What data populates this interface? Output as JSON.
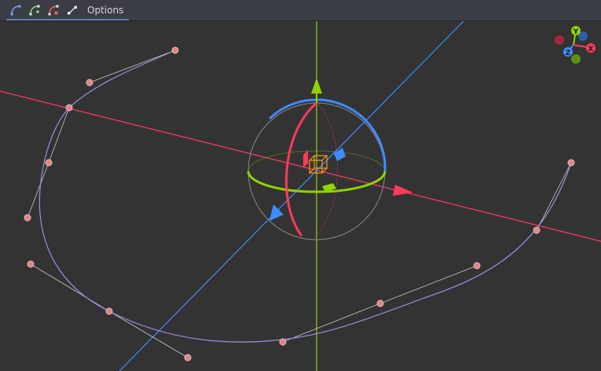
{
  "toolbar": {
    "buttons": [
      {
        "icon": "curve-select-points-icon"
      },
      {
        "icon": "curve-add-point-icon"
      },
      {
        "icon": "curve-delete-point-icon"
      },
      {
        "icon": "curve-close-icon"
      }
    ],
    "options_label": "Options",
    "accent_color": "#5c7fb3"
  },
  "viewport": {
    "background": "#333333",
    "axis_colors": {
      "x": "#ff3b5c",
      "y": "#8fd400",
      "z": "#3d8dff"
    },
    "path_color": "#9b8fe0",
    "point_color": "#e08585"
  },
  "orientation_gizmo": {
    "labels": {
      "x": "X",
      "y": "Y",
      "z": "Z"
    }
  }
}
